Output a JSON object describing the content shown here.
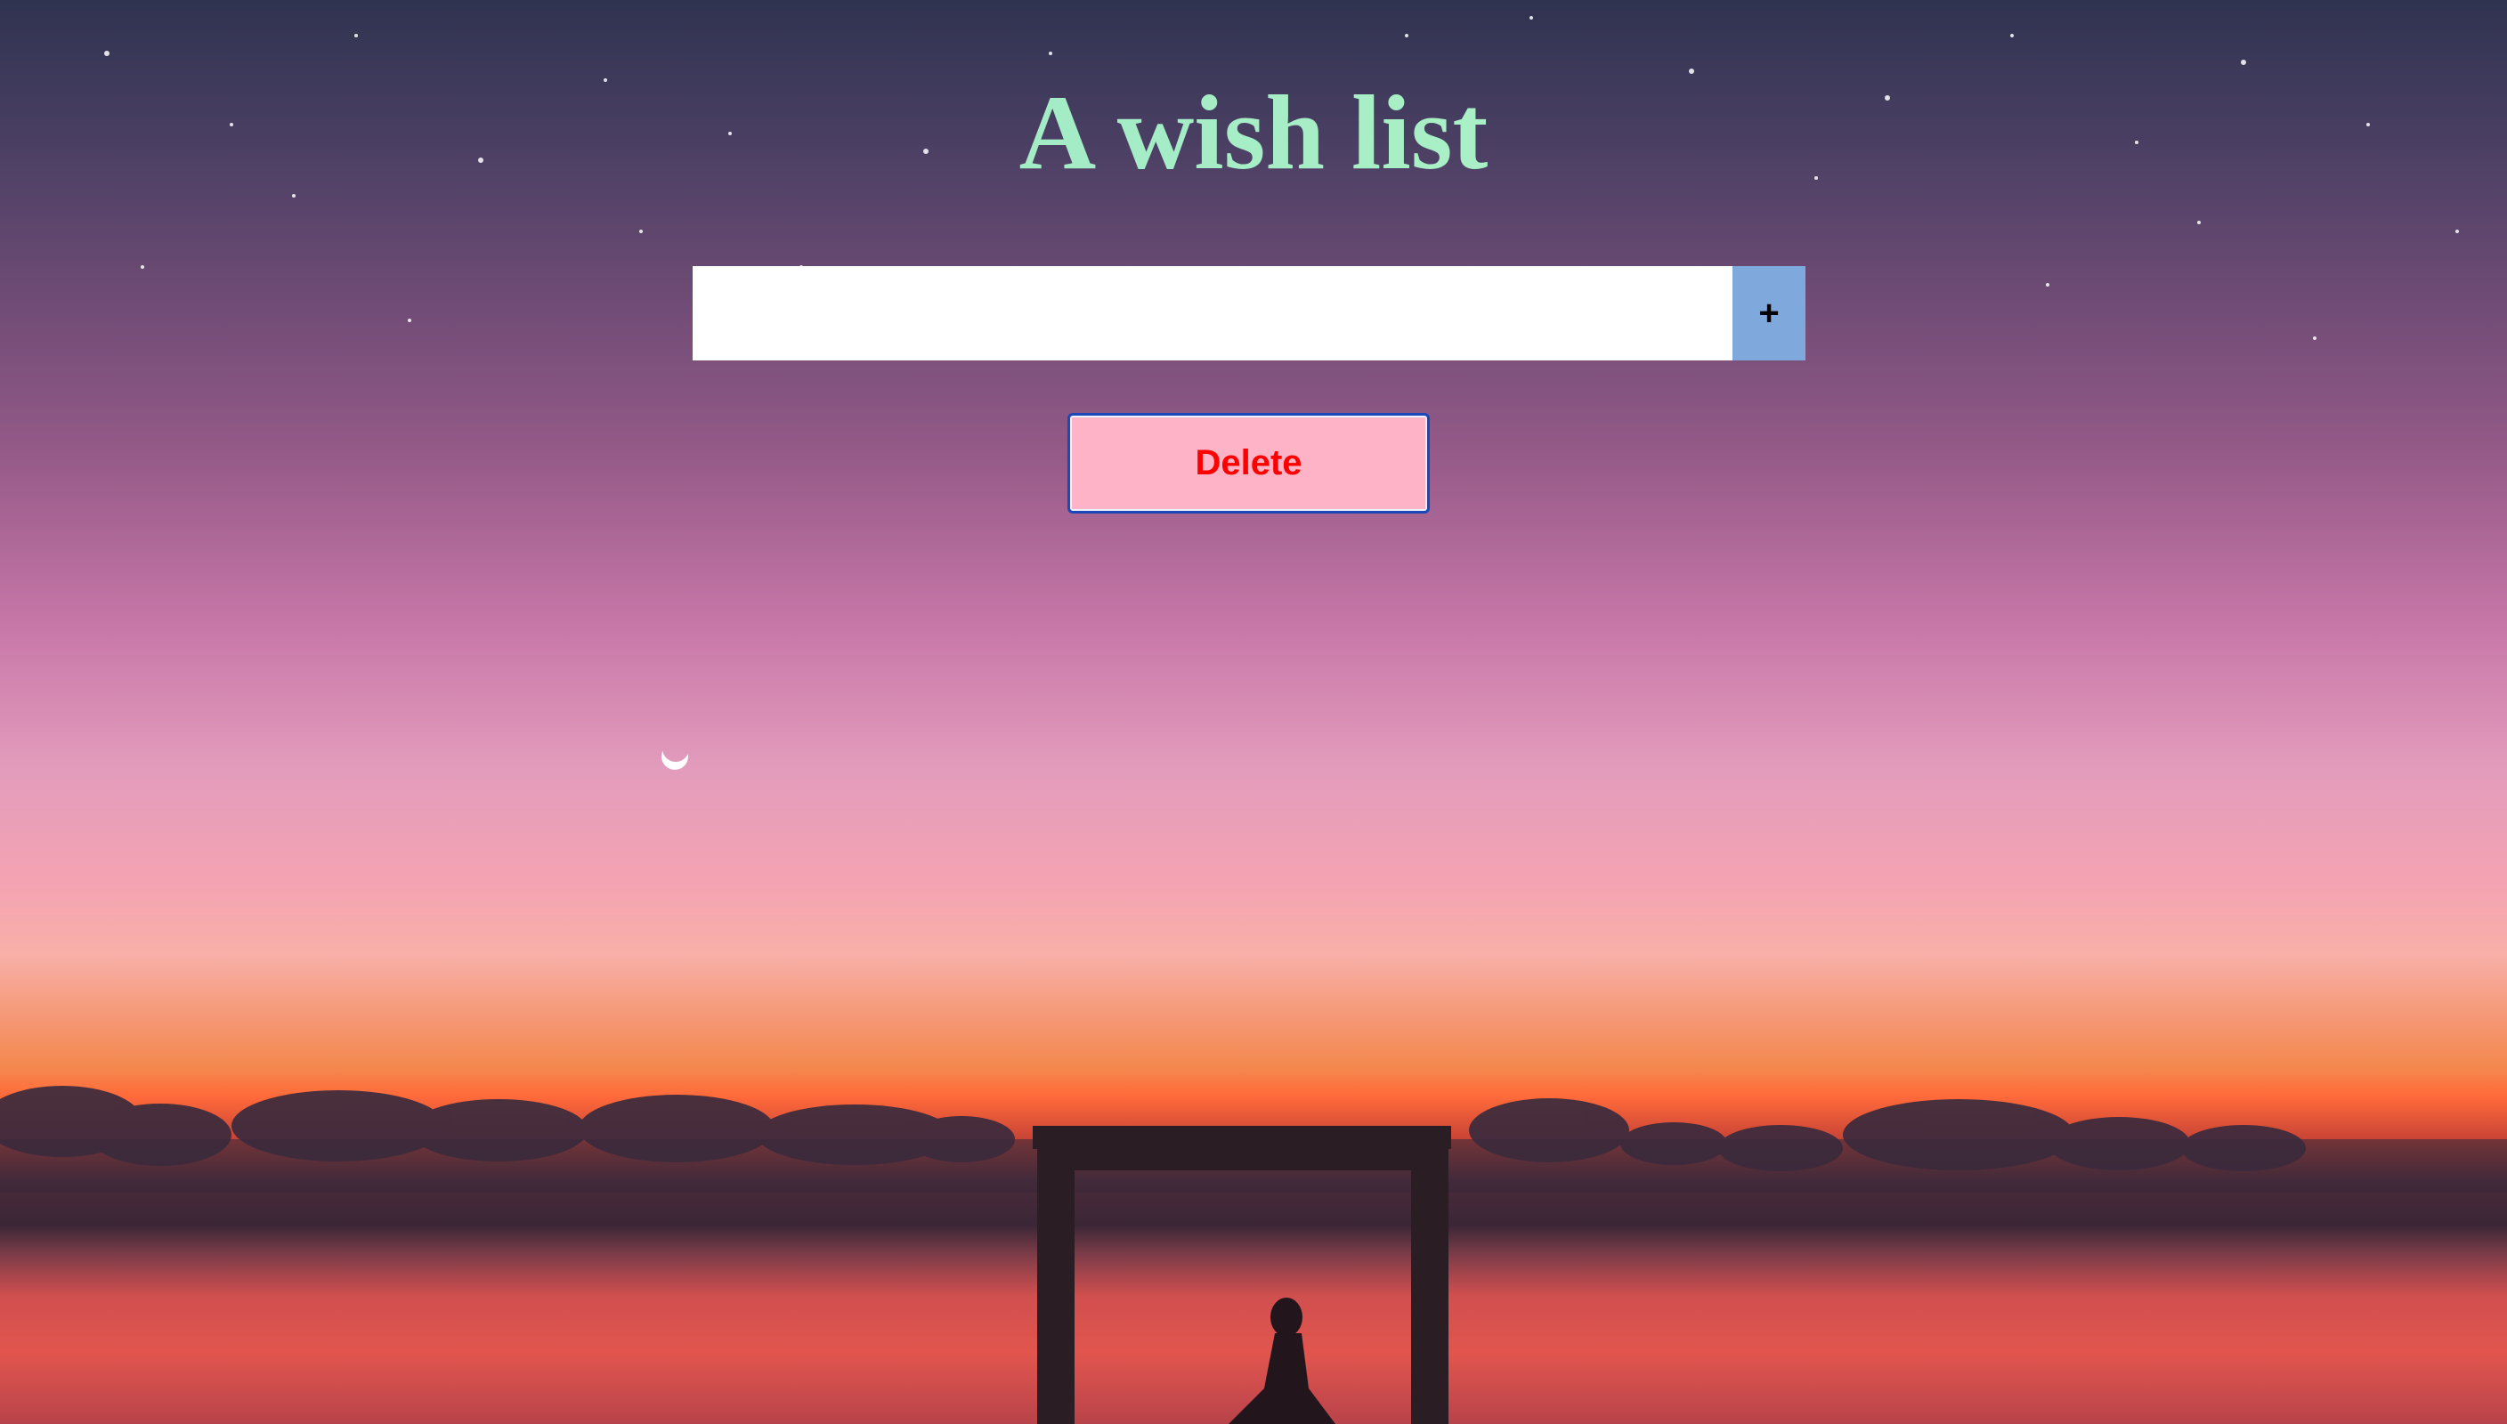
{
  "page": {
    "title": "A wish list"
  },
  "form": {
    "input_value": "",
    "input_placeholder": "",
    "add_button_label": "+",
    "delete_button_label": "Delete"
  },
  "colors": {
    "title_gradient": [
      "#8fb3dc",
      "#9fe9c5",
      "#85b7dc"
    ],
    "add_button_bg": "#7fa9dc",
    "delete_button_bg": "#ffb3c6",
    "delete_button_text": "#ff0000",
    "delete_button_border": "#1c47b8"
  },
  "background": {
    "description_icon": "sunset-beach-photo-icon"
  }
}
